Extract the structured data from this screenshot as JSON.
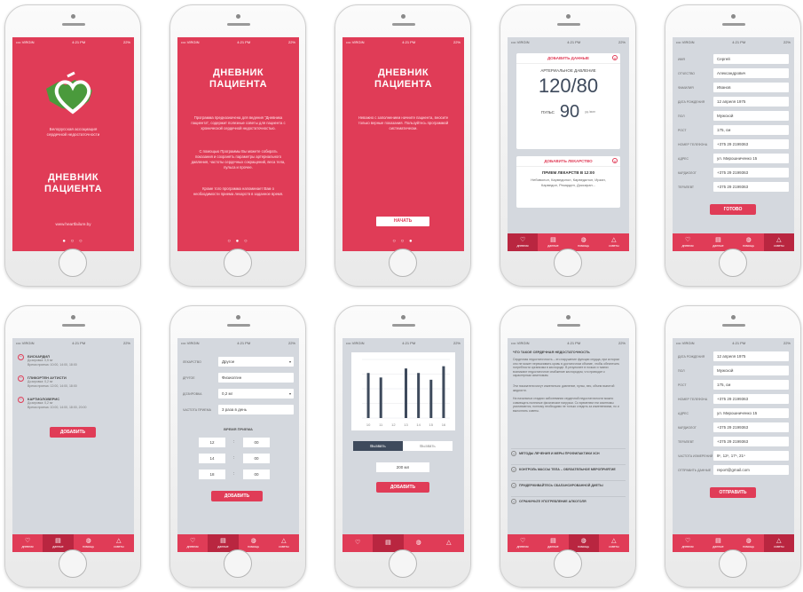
{
  "status": {
    "carrier": "•••• VIRGIN",
    "time": "4:21 PM",
    "battery": "22%"
  },
  "splash": {
    "assoc_line1": "Белорусская ассоциация",
    "assoc_line2": "сердечной недостаточности",
    "title_line1": "ДНЕВНИК",
    "title_line2": "ПАЦИЕНТА",
    "url": "www.heartfailure.by"
  },
  "intro2": {
    "title_line1": "ДНЕВНИК",
    "title_line2": "ПАЦИЕНТА",
    "p1": "Программа предназначена для ведения \"Дневника пациента\", содержит полезные советы для пациента с хронической сердечной недостаточностью.",
    "p2": "С помощью Программы Вы можете собирать показания и сохранять параметры артериального давления, частоты сердечных сокращений, веса тела, пульса и прочее.",
    "p3": "Кроме того программа напоминает Вам о необходимости приема лекарств в заданное время."
  },
  "intro3": {
    "title_line1": "ДНЕВНИК",
    "title_line2": "ПАЦИЕНТА",
    "p1": "Неважно с заполнением начните пациента, вносите только верные показания. Пользуйтесь программой систематически.",
    "start_button": "НАЧАТЬ"
  },
  "data_screen": {
    "add_data": "ДОБАВИТЬ ДАННЫЕ",
    "pressure_label": "АРТЕРИАЛЬНОЕ ДАВЛЕНИЕ",
    "pressure_value": "120/80",
    "pulse_label": "ПУЛЬС",
    "pulse_value": "90",
    "pulse_unit": "уд./мин",
    "add_med": "ДОБАВИТЬ ЛЕКАРСТВО",
    "med_title": "ПРИЕМ ЛЕКАРСТВ В 12:00",
    "med_list": "Небиволол, Карведилол, Карведилол, Ирзан, Карведил, Рекарден, Доксиран..."
  },
  "tabs": [
    "дневник",
    "данные",
    "помощь",
    "советы"
  ],
  "profile": {
    "rows": [
      {
        "label": "ИМЯ",
        "value": "Сергей"
      },
      {
        "label": "ОТЧЕСТВО",
        "value": "Александрович"
      },
      {
        "label": "ФАМИЛИЯ",
        "value": "Иванов"
      },
      {
        "label": "ДАТА РОЖДЕНИЯ",
        "value": "12 апреля 1975"
      },
      {
        "label": "ПОЛ",
        "value": "Мужской"
      },
      {
        "label": "РОСТ",
        "value": "175, см"
      },
      {
        "label": "НОМЕР ТЕЛЕФОНА",
        "value": "+375 29 2199363"
      },
      {
        "label": "АДРЕС",
        "value": "ул. Мирошниченко 15"
      },
      {
        "label": "КАРДИОЛОГ",
        "value": "+375 29 2199363"
      },
      {
        "label": "ТЕРАПЕВТ",
        "value": "+375 29 2199363"
      }
    ],
    "done_button": "ГОТОВО"
  },
  "meds": {
    "items": [
      {
        "name": "БИСКАРДИЛ",
        "dose": "Дозировка: 0,5 мг",
        "time": "Время приема: 10:00, 14:00, 18:00"
      },
      {
        "name": "ГЛИКОРТЕН АУТИСТИ",
        "dose": "Дозировка: 0,2 мг",
        "time": "Время приема: 12:00, 14:00, 18:00"
      },
      {
        "name": "КАРТИОЛОВЕРИС",
        "dose": "Дозировка: 0,2 мг",
        "time": "Время приема: 10:00, 14:00, 18:00, 20:00"
      }
    ],
    "add_button": "ДОБАВИТЬ"
  },
  "med_form": {
    "rows": [
      {
        "label": "ЛЕКАРСТВО",
        "value": "Другое"
      },
      {
        "label": "ДРУГОЕ",
        "value": "Физиолгин"
      },
      {
        "label": "ДОЗИРОВКА",
        "value": "0,2 мг"
      },
      {
        "label": "ЧАСТОТА ПРИЕМА",
        "value": "3 раза в день"
      }
    ],
    "time_label": "ВРЕМЯ ПРИЕМА",
    "times": [
      [
        "12",
        "00"
      ],
      [
        "14",
        "00"
      ],
      [
        "18",
        "00"
      ]
    ],
    "add_button": "ДОБАВИТЬ"
  },
  "chart_screen": {
    "toggle_left": "Вызвать",
    "toggle_right": "Вызвать",
    "input_value": "200 мл",
    "add_button": "ДОБАВИТЬ"
  },
  "chart_data": {
    "type": "bar",
    "categories": [
      "10",
      "11",
      "12",
      "13",
      "14",
      "15",
      "16"
    ],
    "values": [
      100,
      90,
      0,
      110,
      100,
      85,
      115
    ],
    "ylim": [
      0,
      130
    ]
  },
  "article": {
    "heading": "ЧТО ТАКОЕ СЕРДЕЧНАЯ НЕДОСТАТОЧНОСТЬ",
    "p1": "Сердечная недостаточность – это нарушение функции сердца, при котором оно не может перекачивать кровь в достаточном объеме, чтобы обеспечить потребности организма в кислороде. В результате в почках и тканях возникают недостаточное снабжение кислородом, что приводит к характерным симптомам.",
    "p2": "Эти показатели могут изменяться: давление, пульс, вес, объем выпитой жидкости.",
    "p3": "На начальных стадиях заболевания сердечной недостаточности можно совмещать полезные физические нагрузки. Со временем эти симптомы усиливаются, поэтому необходимо не только следить за изменениями, но и выполнять советы.",
    "rows": [
      "МЕТОДЫ ЛЕЧЕНИЯ И МЕРЫ ПРОФИЛАКТИКИ ХСН",
      "КОНТРОЛЬ МАССЫ ТЕЛА – ОБЯЗАТЕЛЬНОЕ МЕРОПРИЯТИЕ",
      "ПРИДЕРЖИВАЙТЕСЬ СБАЛАНСИРОВАННОЙ ДИЕТЫ",
      "ОГРАНИЧЬТЕ УПОТРЕБЛЕНИЕ АЛКОГОЛЯ"
    ]
  },
  "profile2": {
    "rows": [
      {
        "label": "ДАТА РОЖДЕНИЯ",
        "value": "12 апреля 1975"
      },
      {
        "label": "ПОЛ",
        "value": "Мужской"
      },
      {
        "label": "РОСТ",
        "value": "175, см"
      },
      {
        "label": "НОМЕР ТЕЛЕФОНА",
        "value": "+375 29 2199363"
      },
      {
        "label": "АДРЕС",
        "value": "ул. Мирошниченко 15"
      },
      {
        "label": "КАРДИОЛОГ",
        "value": "+375 29 2199363"
      },
      {
        "label": "ТЕРАПЕВТ",
        "value": "+375 29 2199363"
      },
      {
        "label": "ЧАСТОТА ИЗМЕРЕНИЙ",
        "value": "8ⁿ, 12ⁿ, 17ⁿ, 21ⁿ"
      },
      {
        "label": "ОТПРАВИТЬ ДАННЫЕ",
        "value": "report@gmail.com"
      }
    ],
    "send_button": "ОТПРАВИТЬ"
  },
  "colors": {
    "accent": "#e03c57",
    "accent_dark": "#b92640",
    "screen_gray": "#d4d8de",
    "chart_bar": "#3e4a5c"
  }
}
